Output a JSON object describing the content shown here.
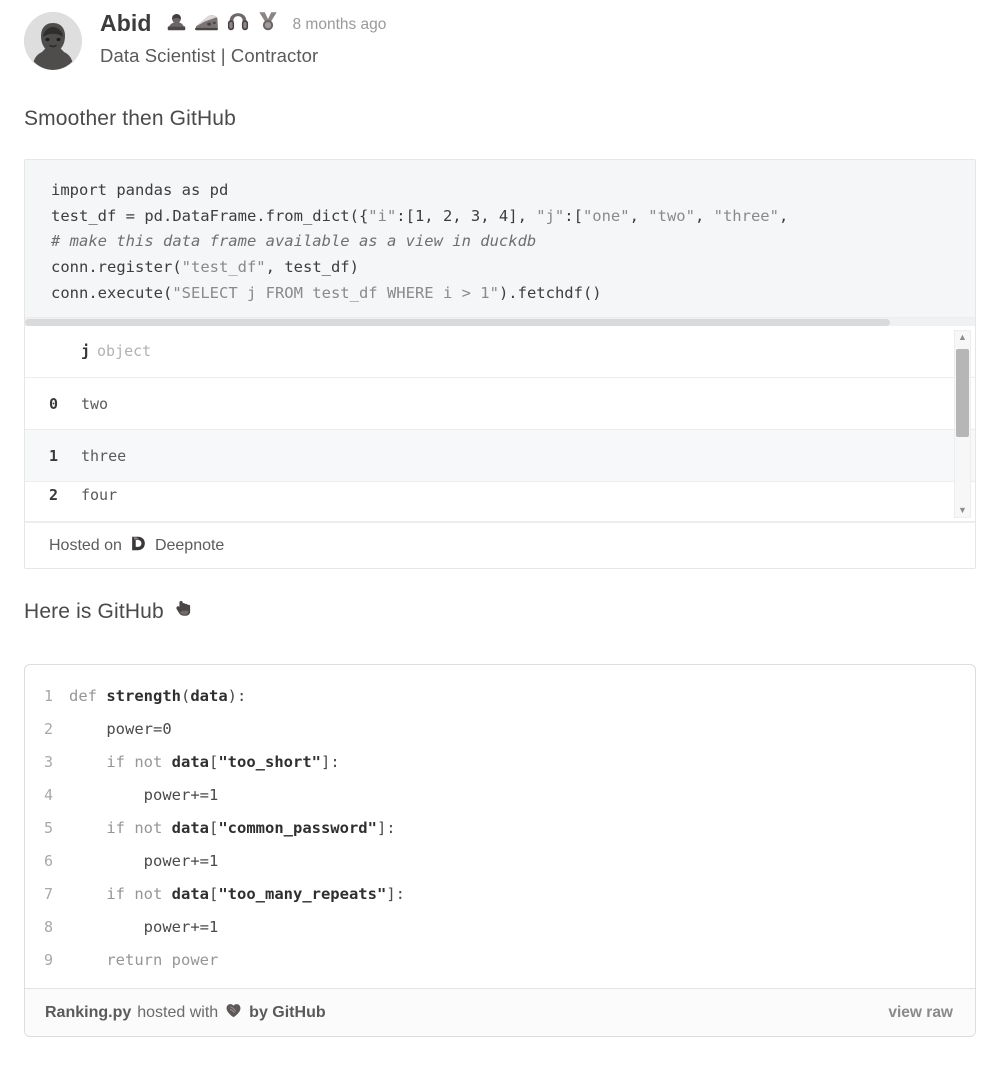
{
  "author": {
    "name": "Abid",
    "timestamp": "8 months ago",
    "subtitle": "Data Scientist | Contractor",
    "avatar_icon": "user-avatar",
    "badges": [
      {
        "icon": "bust-silhouette-badge-icon"
      },
      {
        "icon": "cheese-wedge-badge-icon"
      },
      {
        "icon": "earmuffs-badge-icon"
      },
      {
        "icon": "medal-badge-icon"
      }
    ]
  },
  "sections": {
    "smoother_heading": "Smoother then GitHub",
    "here_heading": "Here is GitHub",
    "here_heading_icon": "backhand-index-pointing-down-icon"
  },
  "deepnote": {
    "code_lines": [
      {
        "segments": [
          {
            "t": "import pandas as pd",
            "k": "plain"
          }
        ]
      },
      {
        "segments": [
          {
            "t": "test_df = pd.DataFrame.from_dict({",
            "k": "plain"
          },
          {
            "t": "\"i\"",
            "k": "str"
          },
          {
            "t": ":[1, 2, 3, 4], ",
            "k": "plain"
          },
          {
            "t": "\"j\"",
            "k": "str"
          },
          {
            "t": ":[",
            "k": "plain"
          },
          {
            "t": "\"one\", \"two\", \"three\",",
            "k": "str"
          }
        ]
      },
      {
        "segments": [
          {
            "t": "# make this data frame available as a view in duckdb",
            "k": "cmt"
          }
        ]
      },
      {
        "segments": [
          {
            "t": "conn.register(",
            "k": "plain"
          },
          {
            "t": "\"test_df\"",
            "k": "str"
          },
          {
            "t": ", test_df)",
            "k": "plain"
          }
        ]
      },
      {
        "segments": [
          {
            "t": "conn.execute(",
            "k": "plain"
          },
          {
            "t": "\"SELECT j FROM test_df WHERE i > 1\"",
            "k": "str"
          },
          {
            "t": ").fetchdf()",
            "k": "plain"
          }
        ]
      }
    ],
    "table": {
      "index_header": "",
      "column_name": "j",
      "column_type": "object",
      "rows": [
        {
          "index": "0",
          "value": "two"
        },
        {
          "index": "1",
          "value": "three"
        },
        {
          "index": "2",
          "value": "four"
        }
      ]
    },
    "scrollbar": {
      "up_arrow_icon": "scroll-up-arrow-icon",
      "down_arrow_icon": "scroll-down-arrow-icon"
    },
    "footer": {
      "hosted_on": "Hosted on",
      "brand": "Deepnote",
      "brand_icon": "deepnote-logo-icon"
    }
  },
  "gist": {
    "lines": [
      {
        "number": "1",
        "segments": [
          {
            "t": "def ",
            "k": "kw"
          },
          {
            "t": "strength",
            "k": "bold"
          },
          {
            "t": "(",
            "k": "pl"
          },
          {
            "t": "data",
            "k": "bold"
          },
          {
            "t": "):",
            "k": "pl"
          }
        ]
      },
      {
        "number": "2",
        "segments": [
          {
            "t": "    power=0",
            "k": "pl"
          }
        ]
      },
      {
        "number": "3",
        "segments": [
          {
            "t": "    if not ",
            "k": "kw"
          },
          {
            "t": "data",
            "k": "bold"
          },
          {
            "t": "[",
            "k": "pl"
          },
          {
            "t": "\"too_short\"",
            "k": "bold"
          },
          {
            "t": "]:",
            "k": "pl"
          }
        ]
      },
      {
        "number": "4",
        "segments": [
          {
            "t": "        power+=1",
            "k": "pl"
          }
        ]
      },
      {
        "number": "5",
        "segments": [
          {
            "t": "    if not ",
            "k": "kw"
          },
          {
            "t": "data",
            "k": "bold"
          },
          {
            "t": "[",
            "k": "pl"
          },
          {
            "t": "\"common_password\"",
            "k": "bold"
          },
          {
            "t": "]:",
            "k": "pl"
          }
        ]
      },
      {
        "number": "6",
        "segments": [
          {
            "t": "        power+=1",
            "k": "pl"
          }
        ]
      },
      {
        "number": "7",
        "segments": [
          {
            "t": "    if not ",
            "k": "kw"
          },
          {
            "t": "data",
            "k": "bold"
          },
          {
            "t": "[",
            "k": "pl"
          },
          {
            "t": "\"too_many_repeats\"",
            "k": "bold"
          },
          {
            "t": "]:",
            "k": "pl"
          }
        ]
      },
      {
        "number": "8",
        "segments": [
          {
            "t": "        power+=1",
            "k": "pl"
          }
        ]
      },
      {
        "number": "9",
        "segments": [
          {
            "t": "    return power",
            "k": "kw"
          }
        ]
      }
    ],
    "footer": {
      "filename": "Ranking.py",
      "hosted_with": "hosted with",
      "heart_icon": "heart-icon",
      "by": "by GitHub",
      "view_raw": "view raw"
    }
  },
  "colors": {
    "text": "#4a4a4a",
    "muted": "#9a9a9a",
    "code_bg": "#f5f6f7",
    "border": "#e6e6e6",
    "gist_border": "#dddddd",
    "zebra": "#f7f8f9"
  }
}
